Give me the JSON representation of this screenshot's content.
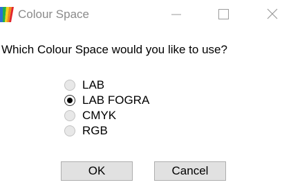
{
  "window": {
    "title": "Colour Space",
    "icon": "app-palette-icon",
    "controls": {
      "minimize": "minimize-icon",
      "maximize": "maximize-icon",
      "close": "close-icon"
    }
  },
  "dialog": {
    "prompt": "Which Colour Space would you like to use?",
    "options": [
      {
        "label": "LAB",
        "checked": false
      },
      {
        "label": "LAB FOGRA",
        "checked": true
      },
      {
        "label": "CMYK",
        "checked": false
      },
      {
        "label": "RGB",
        "checked": false
      }
    ],
    "buttons": {
      "ok": "OK",
      "cancel": "Cancel"
    }
  },
  "colors": {
    "title_text": "#8a8a8a",
    "button_face": "#e1e1e1",
    "button_border": "#adadad"
  }
}
